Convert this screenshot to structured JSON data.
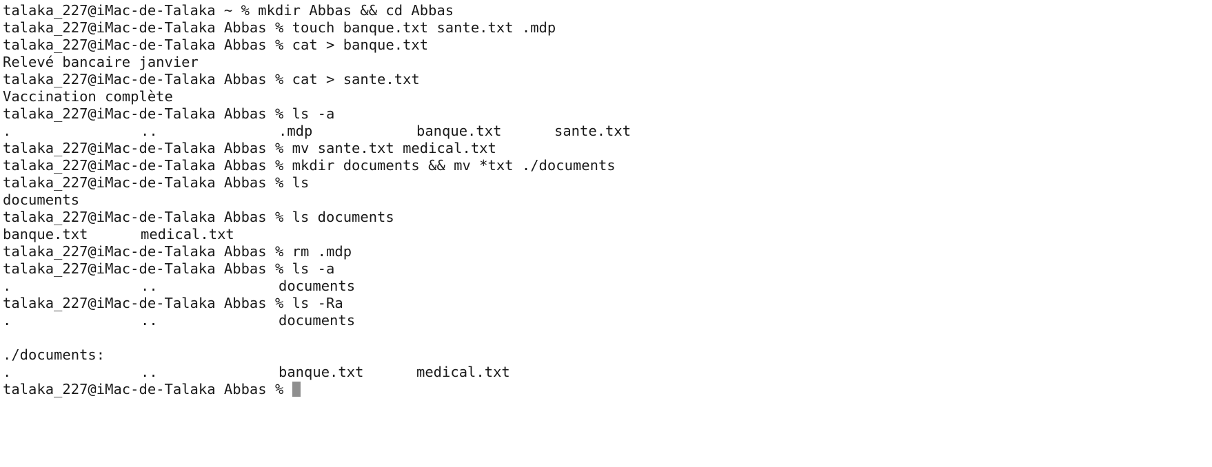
{
  "terminal": {
    "prompt_home": "talaka_227@iMac-de-Talaka ~ % ",
    "prompt_abbas": "talaka_227@iMac-de-Talaka Abbas % ",
    "lines": [
      {
        "type": "cmd",
        "prompt": "talaka_227@iMac-de-Talaka ~ % ",
        "text": "mkdir Abbas && cd Abbas"
      },
      {
        "type": "cmd",
        "prompt": "talaka_227@iMac-de-Talaka Abbas % ",
        "text": "touch banque.txt sante.txt .mdp"
      },
      {
        "type": "cmd",
        "prompt": "talaka_227@iMac-de-Talaka Abbas % ",
        "text": "cat > banque.txt"
      },
      {
        "type": "out",
        "text": "Relevé bancaire janvier"
      },
      {
        "type": "cmd",
        "prompt": "talaka_227@iMac-de-Talaka Abbas % ",
        "text": "cat > sante.txt"
      },
      {
        "type": "out",
        "text": "Vaccination complète"
      },
      {
        "type": "cmd",
        "prompt": "talaka_227@iMac-de-Talaka Abbas % ",
        "text": "ls -a"
      },
      {
        "type": "cols",
        "cols": [
          ".",
          "..",
          ".mdp",
          "banque.txt",
          "sante.txt"
        ]
      },
      {
        "type": "cmd",
        "prompt": "talaka_227@iMac-de-Talaka Abbas % ",
        "text": "mv sante.txt medical.txt"
      },
      {
        "type": "cmd",
        "prompt": "talaka_227@iMac-de-Talaka Abbas % ",
        "text": "mkdir documents && mv *txt ./documents"
      },
      {
        "type": "cmd",
        "prompt": "talaka_227@iMac-de-Talaka Abbas % ",
        "text": "ls"
      },
      {
        "type": "out",
        "text": "documents"
      },
      {
        "type": "cmd",
        "prompt": "talaka_227@iMac-de-Talaka Abbas % ",
        "text": "ls documents"
      },
      {
        "type": "cols",
        "cols": [
          "banque.txt",
          "medical.txt"
        ]
      },
      {
        "type": "cmd",
        "prompt": "talaka_227@iMac-de-Talaka Abbas % ",
        "text": "rm .mdp"
      },
      {
        "type": "cmd",
        "prompt": "talaka_227@iMac-de-Talaka Abbas % ",
        "text": "ls -a"
      },
      {
        "type": "cols",
        "cols": [
          ".",
          "..",
          "documents"
        ]
      },
      {
        "type": "cmd",
        "prompt": "talaka_227@iMac-de-Talaka Abbas % ",
        "text": "ls -Ra"
      },
      {
        "type": "cols",
        "cols": [
          ".",
          "..",
          "documents"
        ]
      },
      {
        "type": "out",
        "text": ""
      },
      {
        "type": "out",
        "text": "./documents:"
      },
      {
        "type": "cols",
        "cols": [
          ".",
          "..",
          "banque.txt",
          "medical.txt"
        ]
      },
      {
        "type": "active",
        "prompt": "talaka_227@iMac-de-Talaka Abbas % ",
        "text": ""
      }
    ]
  },
  "colors": {
    "background": "#ffffff",
    "text": "#1a1a1a",
    "cursor": "#8f8f8f"
  }
}
